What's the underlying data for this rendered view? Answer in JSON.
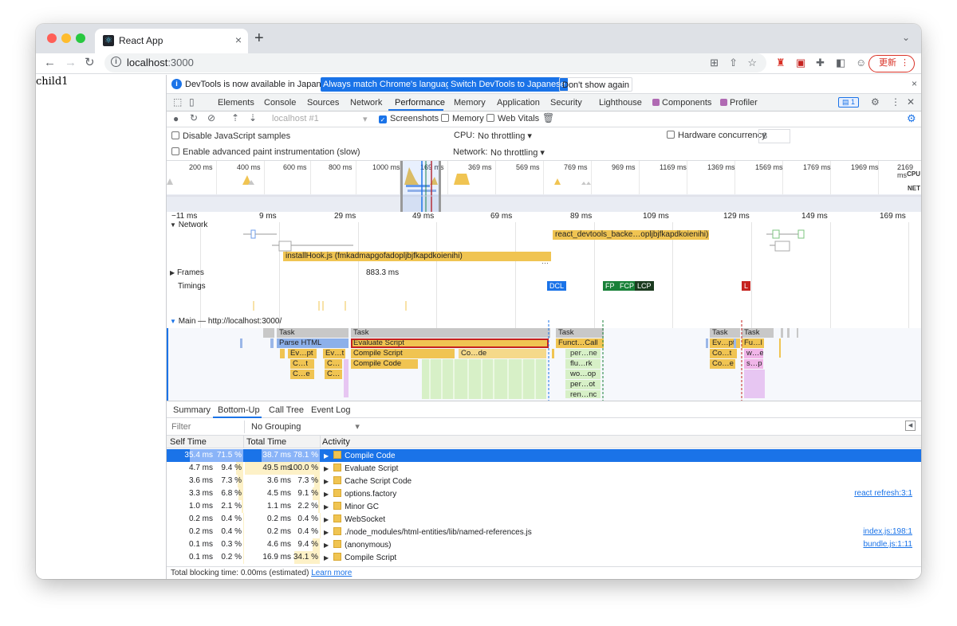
{
  "browser": {
    "tab_title": "React App",
    "tab_close": "×",
    "new_tab": "+",
    "url_host": "localhost",
    "url_port": ":3000",
    "update_label": "更新"
  },
  "page": {
    "content": "child1"
  },
  "infobar": {
    "message": "DevTools is now available in Japanese!",
    "btn_match": "Always match Chrome's language",
    "btn_switch": "Switch DevTools to Japanese",
    "btn_dont": "Don't show again",
    "close": "×"
  },
  "devtools_tabs": [
    "Elements",
    "Console",
    "Sources",
    "Network",
    "Performance",
    "Memory",
    "Application",
    "Security",
    "Lighthouse",
    "Components",
    "Profiler"
  ],
  "issues_count": "1",
  "perf_controls": {
    "profile_select": "localhost #1",
    "screenshots": "Screenshots",
    "memory": "Memory",
    "web_vitals": "Web Vitals"
  },
  "perf_settings": {
    "disable_js": "Disable JavaScript samples",
    "paint_instr": "Enable advanced paint instrumentation (slow)",
    "cpu_label": "CPU:",
    "cpu_value": "No throttling",
    "net_label": "Network:",
    "net_value": "No throttling",
    "hw_label": "Hardware concurrency",
    "hw_value": "8"
  },
  "overview": {
    "ticks": [
      "200 ms",
      "400 ms",
      "600 ms",
      "800 ms",
      "1000 ms",
      "169 ms",
      "369 ms",
      "569 ms",
      "769 ms",
      "969 ms",
      "1169 ms",
      "1369 ms",
      "1569 ms",
      "1769 ms",
      "1969 ms",
      "2169 ms"
    ],
    "cpu_label": "CPU",
    "net_label": "NET"
  },
  "ruler": [
    "−11 ms",
    "9 ms",
    "29 ms",
    "49 ms",
    "69 ms",
    "89 ms",
    "109 ms",
    "129 ms",
    "149 ms",
    "169 ms"
  ],
  "network": {
    "label": "Network",
    "req_install": "installHook.js (fmkadmapgofadopljbjfkapdkoienihi)",
    "req_react": "react_devtools_backe…opljbjfkapdkoienihi)"
  },
  "frames": {
    "label": "Frames",
    "duration": "883.3 ms"
  },
  "timings": {
    "label": "Timings",
    "dcl": "DCL",
    "fp": "FP",
    "fcp": "FCP",
    "lcp": "LCP",
    "l": "L"
  },
  "main": {
    "label": "Main — http://localhost:3000/",
    "task": "Task",
    "parse_html": "Parse HTML",
    "evaluate_script": "Evaluate Script",
    "compile_script": "Compile Script",
    "compile_code": "Compile Code",
    "co_de": "Co…de",
    "ev_pt": "Ev…pt",
    "ev_t": "Ev…t",
    "c_t": "C…t",
    "c_dots": "C…",
    "c_e": "C…e",
    "funct_call": "Funct…Call",
    "per_ne": "per…ne",
    "flu_rk": "flu…rk",
    "wo_op": "wo…op",
    "per_ot": "per…ot",
    "ren_nc": "ren…nc",
    "co_e": "Co…e",
    "co_t": "Co…t",
    "fu_l": "Fu…l",
    "w_e": "w…e",
    "s_p": "s…p"
  },
  "bottom_tabs": [
    "Summary",
    "Bottom-Up",
    "Call Tree",
    "Event Log"
  ],
  "filter": {
    "placeholder": "Filter",
    "grouping": "No Grouping"
  },
  "table": {
    "headers": [
      "Self Time",
      "Total Time",
      "Activity"
    ],
    "rows": [
      {
        "self": "35.4 ms",
        "self_pct": "71.5 %",
        "self_frac": 0.715,
        "total": "38.7 ms",
        "total_pct": "78.1 %",
        "total_frac": 0.781,
        "activity": "Compile Code",
        "link": ""
      },
      {
        "self": "4.7 ms",
        "self_pct": "9.4 %",
        "self_frac": 0.094,
        "total": "49.5 ms",
        "total_pct": "100.0 %",
        "total_frac": 1.0,
        "activity": "Evaluate Script",
        "link": ""
      },
      {
        "self": "3.6 ms",
        "self_pct": "7.3 %",
        "self_frac": 0.073,
        "total": "3.6 ms",
        "total_pct": "7.3 %",
        "total_frac": 0.073,
        "activity": "Cache Script Code",
        "link": ""
      },
      {
        "self": "3.3 ms",
        "self_pct": "6.8 %",
        "self_frac": 0.068,
        "total": "4.5 ms",
        "total_pct": "9.1 %",
        "total_frac": 0.091,
        "activity": "options.factory",
        "link": "react refresh:3:1"
      },
      {
        "self": "1.0 ms",
        "self_pct": "2.1 %",
        "self_frac": 0.021,
        "total": "1.1 ms",
        "total_pct": "2.2 %",
        "total_frac": 0.022,
        "activity": "Minor GC",
        "link": ""
      },
      {
        "self": "0.2 ms",
        "self_pct": "0.4 %",
        "self_frac": 0.004,
        "total": "0.2 ms",
        "total_pct": "0.4 %",
        "total_frac": 0.004,
        "activity": "WebSocket",
        "link": ""
      },
      {
        "self": "0.2 ms",
        "self_pct": "0.4 %",
        "self_frac": 0.004,
        "total": "0.2 ms",
        "total_pct": "0.4 %",
        "total_frac": 0.004,
        "activity": "./node_modules/html-entities/lib/named-references.js",
        "link": "index.js:198:1"
      },
      {
        "self": "0.1 ms",
        "self_pct": "0.3 %",
        "self_frac": 0.003,
        "total": "4.6 ms",
        "total_pct": "9.4 %",
        "total_frac": 0.094,
        "activity": "(anonymous)",
        "link": "bundle.js:1:11"
      },
      {
        "self": "0.1 ms",
        "self_pct": "0.2 %",
        "self_frac": 0.002,
        "total": "16.9 ms",
        "total_pct": "34.1 %",
        "total_frac": 0.341,
        "activity": "Compile Script",
        "link": ""
      }
    ]
  },
  "footer": {
    "text": "Total blocking time: 0.00ms (estimated)",
    "learn_more": "Learn more"
  },
  "colors": {
    "accent": "#1a73e8",
    "scripting": "#f0c452",
    "parse": "#6d9eeb",
    "task": "#cccccc",
    "dcl": "#1a73e8",
    "fp": "#188038",
    "lcp": "#1b3a1f",
    "l": "#c5221f"
  }
}
